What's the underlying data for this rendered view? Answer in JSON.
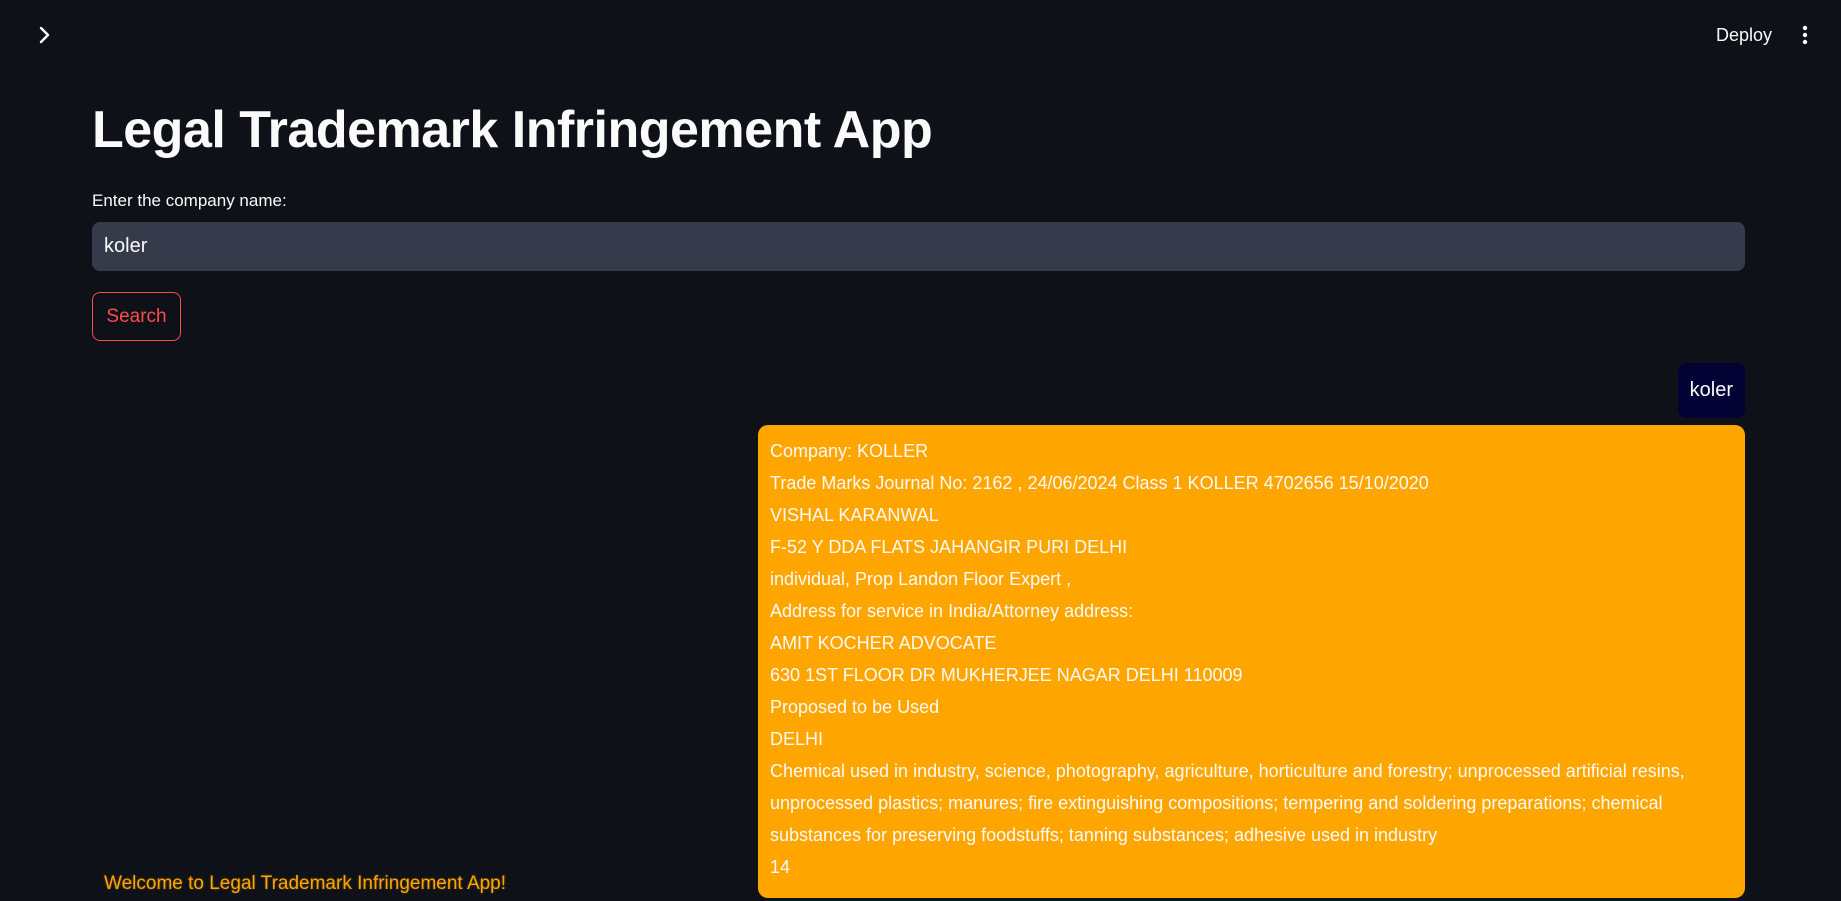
{
  "header": {
    "expand_icon": "chevron-right-icon",
    "deploy_label": "Deploy",
    "menu_icon": "vertical-ellipsis-icon"
  },
  "main": {
    "title": "Legal Trademark Infringement App",
    "input_label": "Enter the company name:",
    "input_value": "koler",
    "search_label": "Search"
  },
  "chat": {
    "user_message": "koler",
    "result_lines": [
      "Company: KOLLER",
      "Trade Marks Journal No: 2162 , 24/06/2024 Class 1 KOLLER 4702656 15/10/2020",
      "VISHAL KARANWAL",
      "F-52 Y DDA FLATS JAHANGIR PURI DELHI",
      "individual, Prop Landon Floor Expert ,",
      "Address for service in India/Attorney address:",
      "AMIT KOCHER ADVOCATE",
      "630 1ST FLOOR DR MUKHERJEE NAGAR DELHI 110009",
      "Proposed to be Used",
      "DELHI",
      "Chemical used in industry, science, photography, agriculture, horticulture and forestry; unprocessed artificial resins, unprocessed plastics; manures; fire extinguishing compositions; tempering and soldering preparations; chemical substances for preserving foodstuffs; tanning substances; adhesive used in industry",
      "14"
    ],
    "result_color": "#ffa500",
    "user_bubble_color": "#020235"
  },
  "footer": {
    "welcome": "Welcome to Legal Trademark Infringement App!"
  },
  "colors": {
    "background": "#0e1117",
    "input_bg": "#353b4b",
    "accent": "#ff4b4b"
  }
}
